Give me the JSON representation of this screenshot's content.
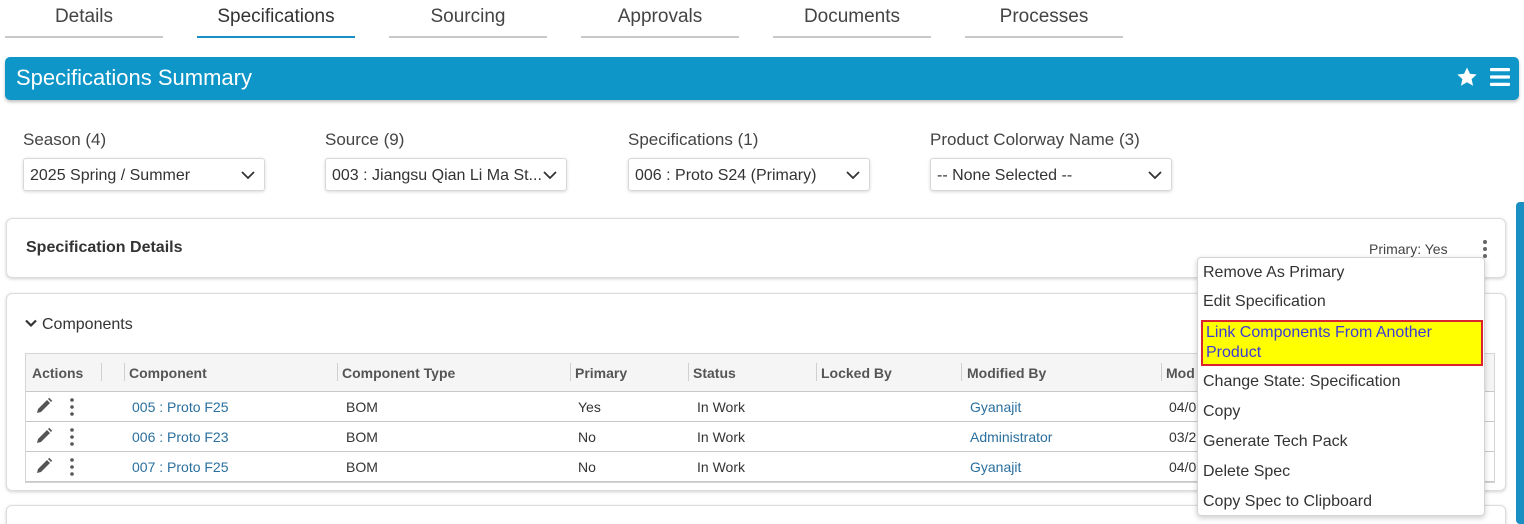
{
  "tabs": [
    "Details",
    "Specifications",
    "Sourcing",
    "Approvals",
    "Documents",
    "Processes"
  ],
  "header": {
    "title": "Specifications Summary"
  },
  "filters": {
    "season": {
      "label": "Season (4)",
      "value": "2025 Spring / Summer"
    },
    "source": {
      "label": "Source (9)",
      "value": "003 : Jiangsu Qian Li Ma St..."
    },
    "specifications": {
      "label": "Specifications (1)",
      "value": "006 : Proto S24 (Primary)"
    },
    "colorway": {
      "label": "Product Colorway Name (3)",
      "value": "-- None Selected --"
    }
  },
  "spec_details": {
    "title": "Specification Details",
    "primary": "Primary: Yes"
  },
  "components": {
    "title": "Components",
    "columns": [
      "Actions",
      "Component",
      "Component Type",
      "Primary",
      "Status",
      "Locked By",
      "Modified By",
      "Mod"
    ],
    "rows": [
      {
        "component": "005 : Proto F25",
        "type": "BOM",
        "primary": "Yes",
        "status": "In Work",
        "locked_by": "",
        "modified_by": "Gyanajit",
        "modified": "04/0"
      },
      {
        "component": "006 : Proto F23",
        "type": "BOM",
        "primary": "No",
        "status": "In Work",
        "locked_by": "",
        "modified_by": "Administrator",
        "modified": "03/2"
      },
      {
        "component": "007 : Proto F25",
        "type": "BOM",
        "primary": "No",
        "status": "In Work",
        "locked_by": "",
        "modified_by": "Gyanajit",
        "modified": "04/0"
      }
    ]
  },
  "menu": {
    "items": [
      "Remove As Primary",
      "Edit Specification",
      "Link Components From Another Product",
      "Change State: Specification",
      "Copy",
      "Generate Tech Pack",
      "Delete Spec",
      "Copy Spec to Clipboard"
    ],
    "highlighted_index": 2
  },
  "colors": {
    "accent": "#0e96c8",
    "link": "#2a6f9e",
    "highlight": "#ffff00",
    "highlight_border": "#d9232d"
  }
}
